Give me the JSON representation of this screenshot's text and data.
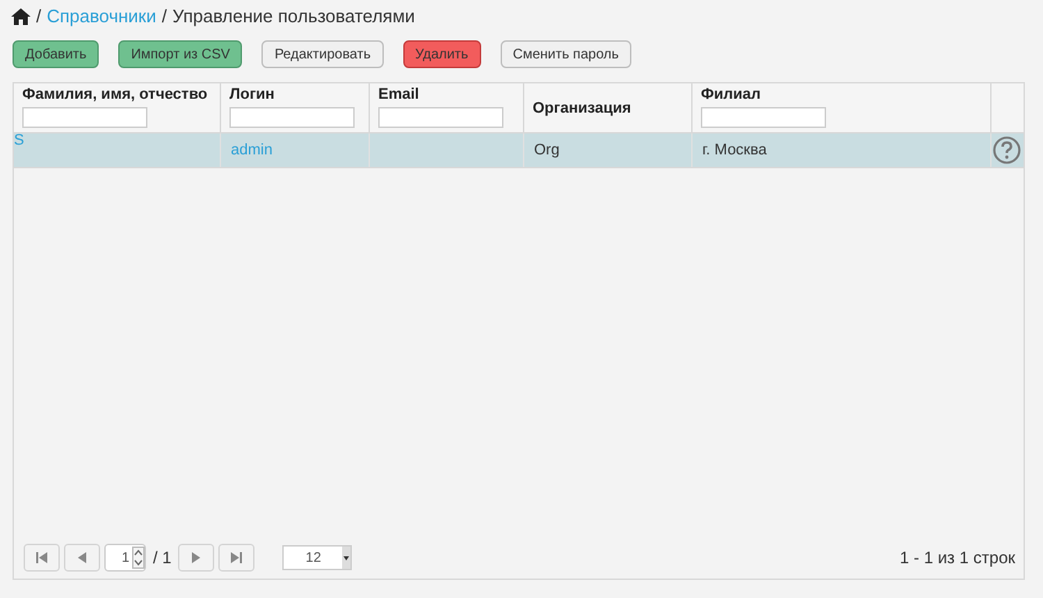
{
  "breadcrumb": [
    {
      "separator": "/",
      "label": "Справочники",
      "kind": "link"
    },
    {
      "separator": "/",
      "label": "Управление пользователями",
      "kind": "text"
    }
  ],
  "toolbar": [
    {
      "label": "Добавить",
      "kind": "success"
    },
    {
      "label": "Импорт из CSV",
      "kind": "success"
    },
    {
      "label": "Редактировать",
      "kind": "default"
    },
    {
      "label": "Удалить",
      "kind": "danger"
    },
    {
      "label": "Сменить пароль",
      "kind": "default"
    }
  ],
  "table": {
    "columns": [
      {
        "label": "Фамилия, имя, отчество",
        "filter": true
      },
      {
        "label": "Логин",
        "filter": true
      },
      {
        "label": "Email",
        "filter": true
      },
      {
        "label": "Организация",
        "filter": false
      },
      {
        "label": "Филиал",
        "filter": true
      }
    ],
    "rows": [
      {
        "fio": "S",
        "login": "admin",
        "organization": "Org",
        "branch": "г. Москва",
        "selected": true
      }
    ]
  },
  "pager": {
    "page": "1",
    "total": "/ 1",
    "page_size": "12",
    "summary": "1 - 1 из 1 строк"
  }
}
